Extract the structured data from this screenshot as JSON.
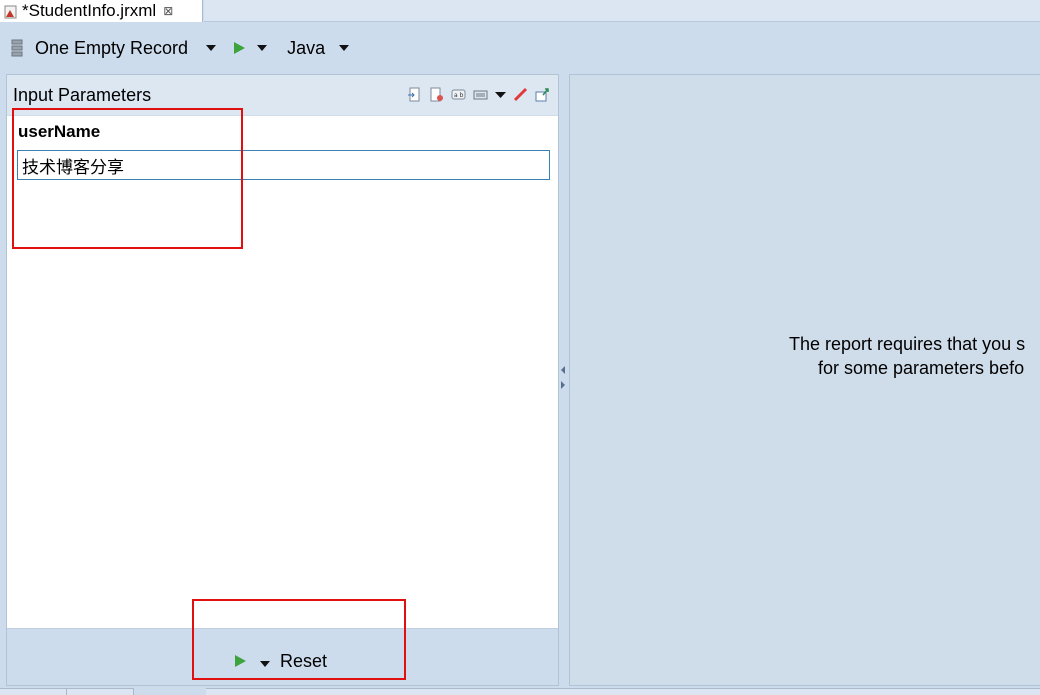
{
  "editor_tab": {
    "title": "*StudentInfo.jrxml",
    "close_glyph": "⊠"
  },
  "toolbar": {
    "data_adapter": "One Empty Record",
    "language": "Java"
  },
  "input_panel": {
    "title": "Input Parameters",
    "parameter": {
      "label": "userName",
      "value": "技术博客分享"
    },
    "footer": {
      "reset_label": "Reset"
    }
  },
  "preview": {
    "message_line1": "The report requires that you s",
    "message_line2": "for some parameters befo"
  },
  "colors": {
    "highlight": "#e01010",
    "accent": "#3da33d",
    "input_border": "#3b7fb3"
  }
}
